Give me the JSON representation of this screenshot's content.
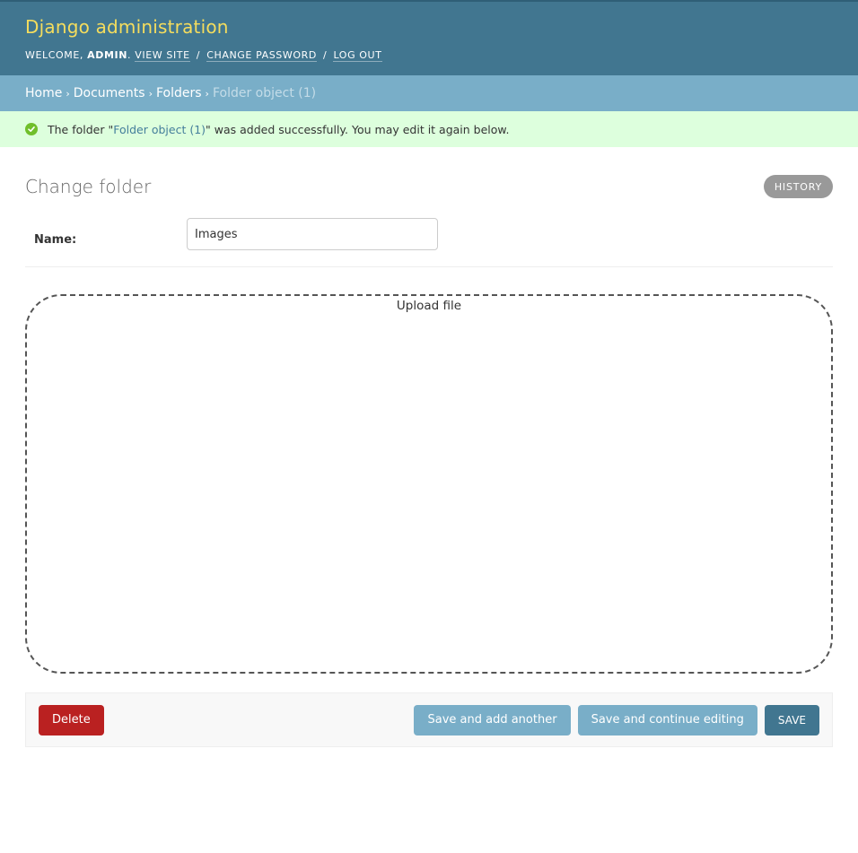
{
  "header": {
    "branding": "Django administration",
    "welcome_prefix": "WELCOME,",
    "username": "ADMIN",
    "view_site": "VIEW SITE",
    "change_password": "CHANGE PASSWORD",
    "log_out": "LOG OUT",
    "separator": "/"
  },
  "breadcrumbs": {
    "home": "Home",
    "app": "Documents",
    "model": "Folders",
    "current": "Folder object (1)",
    "arrow": "›"
  },
  "message": {
    "prefix": "The folder \"",
    "link": "Folder object (1)",
    "suffix": "\" was added successfully. You may edit it again below.",
    "colors": {
      "background": "#ddffdd",
      "icon": "#70bf2b"
    }
  },
  "page": {
    "title": "Change folder",
    "history_label": "HISTORY"
  },
  "form": {
    "name_label": "Name:",
    "name_value": "Images"
  },
  "dropzone": {
    "label": "Upload file"
  },
  "submit_row": {
    "delete_label": "Delete",
    "save_add_another_label": "Save and add another",
    "save_continue_label": "Save and continue editing",
    "save_label": "SAVE"
  },
  "colors": {
    "header_bg": "#417690",
    "branding": "#f5dd5d",
    "breadcrumbs_bg": "#79aec8",
    "delete": "#ba2121",
    "save": "#417690",
    "secondary_button": "#79aec8"
  },
  "icons": {
    "success": "checkmark-circle-icon"
  }
}
